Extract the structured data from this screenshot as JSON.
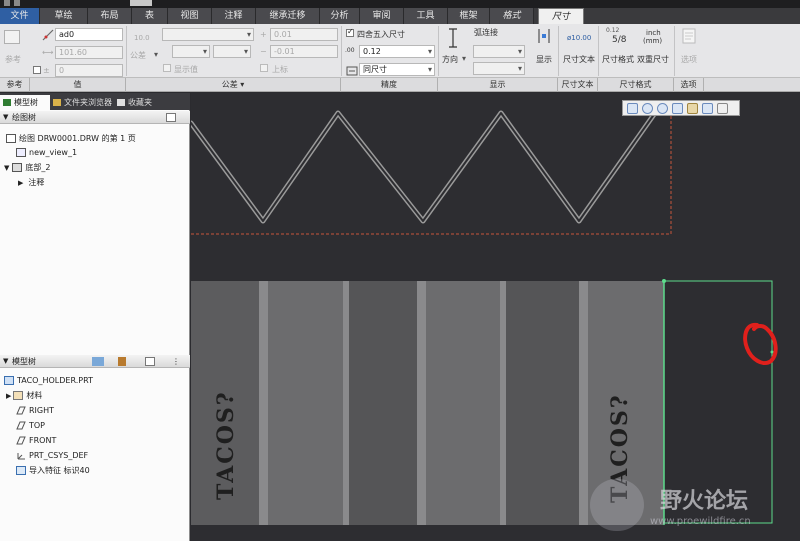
{
  "tabs": [
    "文件",
    "草绘",
    "布局",
    "表",
    "视图",
    "注释",
    "继承迁移",
    "分析",
    "审阅",
    "工具",
    "框架",
    "格式",
    "尺寸"
  ],
  "active_tab": "尺寸",
  "ribbon": {
    "ref_label": "参考",
    "value": {
      "name_field": "ad0",
      "value_field": "101.60",
      "tolerance_field": "0"
    },
    "tolerance": {
      "tol_icon_label": "10.0",
      "tol_dropdown": "公差",
      "upper_field": "0.01",
      "lower_field": "-0.01",
      "show_value": "显示值",
      "superscript": "上标"
    },
    "precision": {
      "round_label": "四舍五入尺寸",
      "decimals": "0.12",
      "units_dropdown": "同尺寸"
    },
    "display": {
      "arc_label": "弧连接",
      "direction_label": "方向",
      "show_label": "显示"
    },
    "dim_text": {
      "text_label": "尺寸文本",
      "preview": "ø10.00"
    },
    "dim_format": {
      "format_label": "尺寸格式",
      "dual_label": "双重尺寸",
      "frac_top": "0.12",
      "frac_mid": "5/8",
      "unit_top": "inch",
      "unit_bot": "(mm)"
    },
    "options_label": "选项"
  },
  "groups": [
    "参考",
    "值",
    "公差 ▾",
    "精度",
    "显示",
    "尺寸文本",
    "尺寸格式",
    "选项"
  ],
  "left_panel": {
    "tabs": [
      "模型树",
      "文件夹浏览器",
      "收藏夹"
    ],
    "drawing_tree": {
      "title": "绘图树",
      "items": [
        "绘图 DRW0001.DRW 的第 1 页",
        "new_view_1",
        "底部_2",
        "注释"
      ]
    },
    "model_tree": {
      "title": "模型树",
      "items": [
        "TACO_HOLDER.PRT",
        "材料",
        "RIGHT",
        "TOP",
        "FRONT",
        "PRT_CSYS_DEF",
        "导入特征 标识40"
      ]
    }
  },
  "canvas": {
    "panel_text_left": "TACOS?",
    "panel_text_right": "TACOS?"
  },
  "watermark": {
    "title": "野火论坛",
    "url": "www.proewildfire.cn"
  },
  "colors": {
    "accent_green": "#5ddc8c",
    "annotation_red": "#e0201c",
    "dashed_border": "#c8553a"
  }
}
